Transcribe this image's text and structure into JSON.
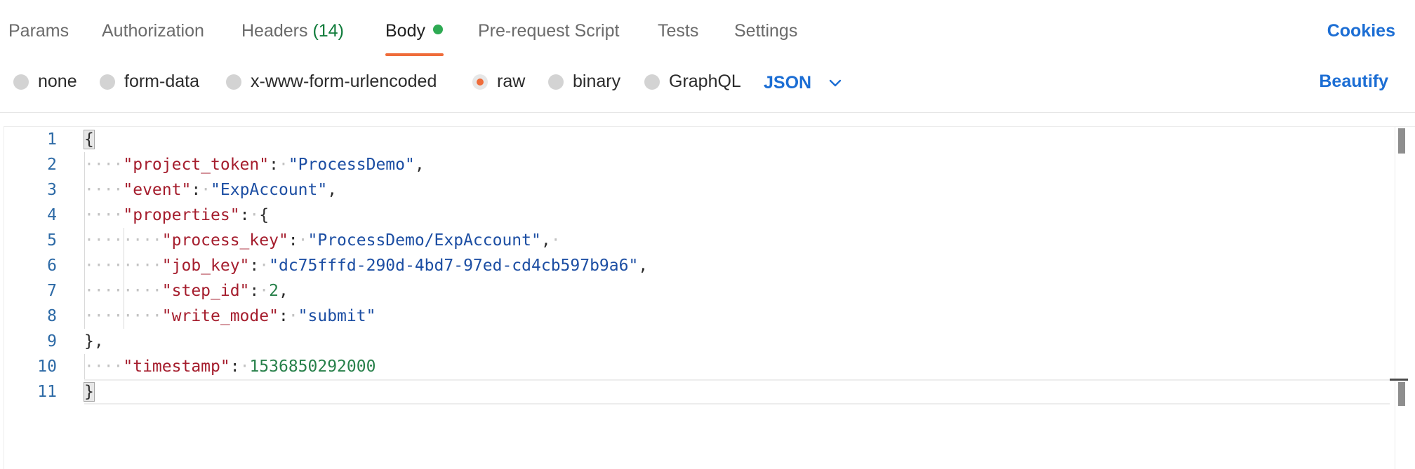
{
  "tabs": {
    "params": "Params",
    "authorization": "Authorization",
    "headers": "Headers",
    "headers_count": "(14)",
    "body": "Body",
    "pre_request": "Pre-request Script",
    "tests": "Tests",
    "settings": "Settings",
    "cookies": "Cookies"
  },
  "body_types": {
    "none": "none",
    "form_data": "form-data",
    "urlencoded": "x-www-form-urlencoded",
    "raw": "raw",
    "binary": "binary",
    "graphql": "GraphQL",
    "selected": "raw",
    "language": "JSON",
    "beautify": "Beautify"
  },
  "colors": {
    "accent_orange": "#ef6c3a",
    "link_blue": "#1c6ed4",
    "status_green": "#2eaa53"
  },
  "editor": {
    "line_numbers": [
      "1",
      "2",
      "3",
      "4",
      "5",
      "6",
      "7",
      "8",
      "9",
      "10",
      "11"
    ],
    "code": {
      "l1_open": "{",
      "project_token_key": "\"project_token\"",
      "project_token_val": "\"ProcessDemo\"",
      "event_key": "\"event\"",
      "event_val": "\"ExpAccount\"",
      "properties_key": "\"properties\"",
      "properties_open": "{",
      "process_key_key": "\"process_key\"",
      "process_key_val": "\"ProcessDemo/ExpAccount\"",
      "job_key_key": "\"job_key\"",
      "job_key_val": "\"dc75fffd-290d-4bd7-97ed-cd4cb597b9a6\"",
      "step_id_key": "\"step_id\"",
      "step_id_val": "2",
      "write_mode_key": "\"write_mode\"",
      "write_mode_val": "\"submit\"",
      "properties_close": "},",
      "timestamp_key": "\"timestamp\"",
      "timestamp_val": "1536850292000",
      "l11_close": "}"
    }
  }
}
